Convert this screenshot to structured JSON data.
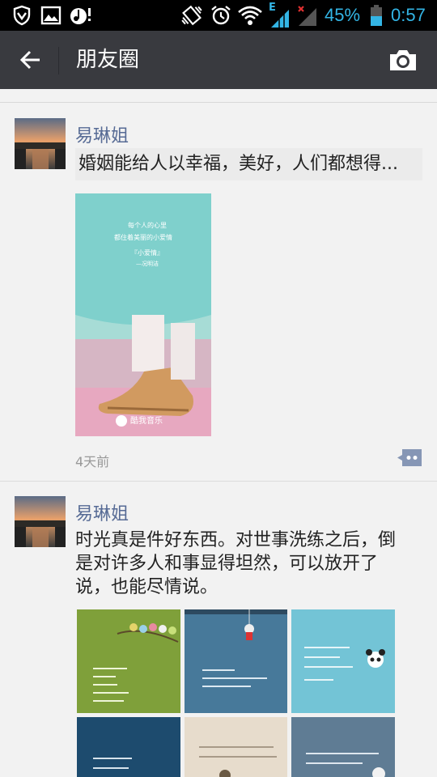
{
  "status_bar": {
    "battery_percent": "45%",
    "time": "0:57",
    "network_label": "E",
    "icons": [
      "shield-icon",
      "picture-icon",
      "music-notification-icon",
      "vibrate-icon",
      "alarm-icon",
      "wifi-icon",
      "signal-icon",
      "no-signal-icon",
      "battery-icon"
    ]
  },
  "action_bar": {
    "back_icon": "arrow-left-icon",
    "title": "朋友圈",
    "camera_icon": "camera-icon"
  },
  "posts": [
    {
      "author": "易琳姐",
      "shared_text": "婚姻能给人以幸福，美好，人们都想得...",
      "image_caption": {
        "line1": "每个人的心里",
        "line2": "都住着美丽的小爱情",
        "line3": "『小爱情』",
        "line4": "—况明洁"
      },
      "image_brand": "酷我音乐",
      "time": "4天前"
    },
    {
      "author": "易琳姐",
      "text_lines": [
        "时光真是件好东西。对世事洗练之后，倒",
        "是对许多人和事显得坦然，可以放开了",
        "说，也能尽情说。"
      ],
      "images": [
        "green-birds-photo",
        "blue-astronaut-photo",
        "blue-panda-photo",
        "navy-quote-photo",
        "beige-quote-photo",
        "grey-quote-photo"
      ]
    }
  ]
}
